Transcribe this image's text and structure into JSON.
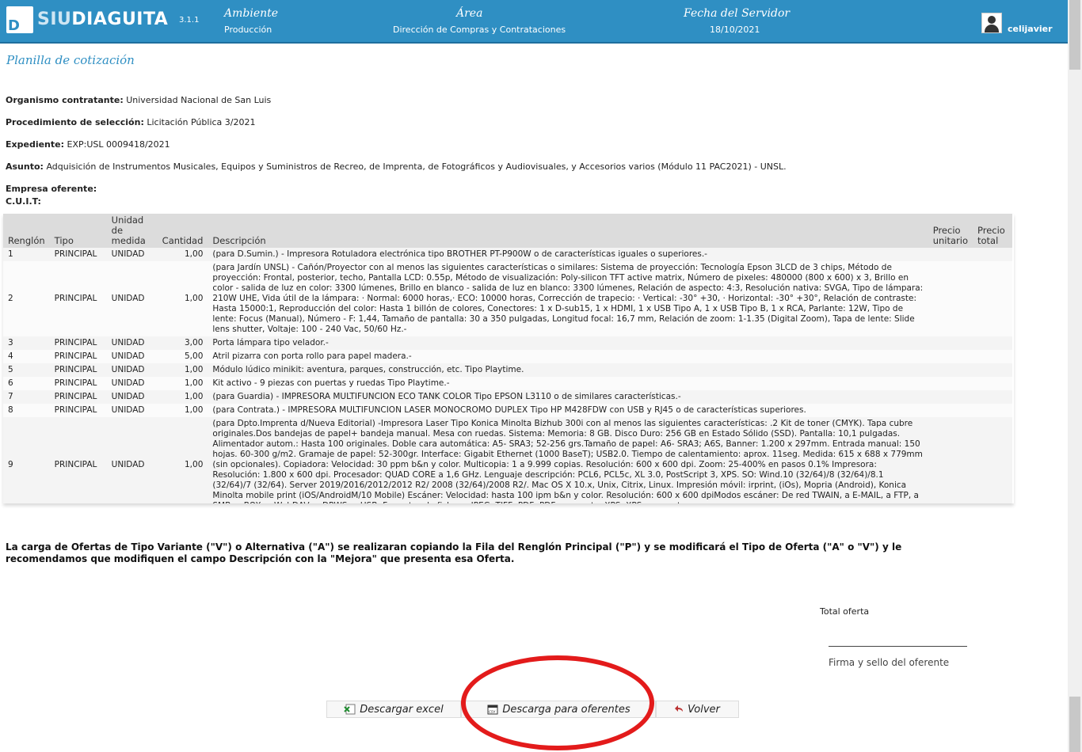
{
  "header": {
    "brand_prefix": "SIU",
    "brand_suffix": "DIAGUITA",
    "version": "3.1.1",
    "ambiente_label": "Ambiente",
    "ambiente_value": "Producción",
    "area_label": "Área",
    "area_value": "Dirección de Compras y Contrataciones",
    "fecha_label": "Fecha del Servidor",
    "fecha_value": "18/10/2021",
    "username": "celijavier"
  },
  "page_title": "Planilla de cotización",
  "fields": {
    "organismo_label": "Organismo contratante:",
    "organismo_value": "Universidad Nacional de San Luis",
    "procedimiento_label": "Procedimiento de selección:",
    "procedimiento_value": "Licitación Pública 3/2021",
    "expediente_label": "Expediente:",
    "expediente_value": "EXP:USL 0009418/2021",
    "asunto_label": "Asunto:",
    "asunto_value": "Adquisición de Instrumentos Musicales, Equipos y Suministros de Recreo, de Imprenta, de Fotográficos y Audiovisuales, y Accesorios varios (Módulo 11 PAC2021) - UNSL.",
    "empresa_label": "Empresa oferente:",
    "cuit_label": "C.U.I.T:"
  },
  "table": {
    "headers": [
      "Renglón",
      "Tipo",
      "Unidad de medida",
      "Cantidad",
      "Descripción",
      "Precio unitario",
      "Precio total"
    ],
    "rows": [
      {
        "renglon": "1",
        "tipo": "PRINCIPAL",
        "unidad": "UNIDAD",
        "cantidad": "1,00",
        "descripcion": "(para D.Sumin.) - Impresora Rotuladora electrónica tipo BROTHER PT-P900W o de características iguales o superiores.-"
      },
      {
        "renglon": "2",
        "tipo": "PRINCIPAL",
        "unidad": "UNIDAD",
        "cantidad": "1,00",
        "descripcion": "(para Jardín UNSL) - Cañón/Proyector con al menos las siguientes características o similares: Sistema de proyección: Tecnología Epson 3LCD de 3 chips, Método de proyección: Frontal, posterior, techo, Pantalla LCD: 0.55p, Método de visualización: Poly-silicon TFT active matrix, Número de pixeles: 480000 (800 x 600) x 3, Brillo en color - salida de luz en color: 3300 lúmenes, Brillo en blanco - salida de luz en blanco: 3300 lúmenes, Relación de aspecto: 4:3, Resolución nativa: SVGA, Tipo de lámpara: 210W UHE, Vida útil de la lámpara: · Normal: 6000 horas,· ECO: 10000 horas, Corrección de trapecio: · Vertical: -30° +30, · Horizontal: -30° +30°, Relación de contraste: Hasta 15000:1, Reproducción del color: Hasta 1 billón de colores, Conectores: 1 x D-sub15, 1 x HDMI, 1 x USB Tipo A, 1 x USB Tipo B, 1 x RCA, Parlante: 12W, Tipo de lente: Focus (Manual), Número - F: 1,44, Tamaño de pantalla: 30 a 350 pulgadas, Longitud focal: 16,7 mm, Relación de zoom: 1-1.35 (Digital Zoom), Tapa de lente: Slide lens shutter, Voltaje: 100 - 240 Vac, 50/60 Hz.-"
      },
      {
        "renglon": "3",
        "tipo": "PRINCIPAL",
        "unidad": "UNIDAD",
        "cantidad": "3,00",
        "descripcion": "Porta lámpara tipo velador.-"
      },
      {
        "renglon": "4",
        "tipo": "PRINCIPAL",
        "unidad": "UNIDAD",
        "cantidad": "5,00",
        "descripcion": "Atril pizarra con porta rollo para papel madera.-"
      },
      {
        "renglon": "5",
        "tipo": "PRINCIPAL",
        "unidad": "UNIDAD",
        "cantidad": "1,00",
        "descripcion": "Módulo lúdico minikit: aventura, parques, construcción, etc. Tipo Playtime."
      },
      {
        "renglon": "6",
        "tipo": "PRINCIPAL",
        "unidad": "UNIDAD",
        "cantidad": "1,00",
        "descripcion": "Kit activo - 9 piezas con puertas y ruedas Tipo Playtime.-"
      },
      {
        "renglon": "7",
        "tipo": "PRINCIPAL",
        "unidad": "UNIDAD",
        "cantidad": "1,00",
        "descripcion": "(para Guardia) - IMPRESORA MULTIFUNCION ECO TANK COLOR Tipo EPSON L3110 o de similares características.-"
      },
      {
        "renglon": "8",
        "tipo": "PRINCIPAL",
        "unidad": "UNIDAD",
        "cantidad": "1,00",
        "descripcion": "(para Contrata.) - IMPRESORA MULTIFUNCION LASER MONOCROMO DUPLEX Tipo HP M428FDW con USB y RJ45 o de características superiores."
      },
      {
        "renglon": "9",
        "tipo": "PRINCIPAL",
        "unidad": "UNIDAD",
        "cantidad": "1,00",
        "descripcion": "(para Dpto.Imprenta d/Nueva Editorial) -Impresora Laser Tipo Konica Minolta Bizhub 300i con al menos las siguientes características: .2 Kit de toner (CMYK). Tapa cubre originales.Dos bandejas de papel+ bandeja manual. Mesa con ruedas. Sistema: Memoria: 8 GB. Disco Duro: 256 GB en Estado Sólido (SSD). Pantalla: 10,1 pulgadas. Alimentador autom.: Hasta 100 originales. Doble cara automática: A5- SRA3; 52-256 grs.Tamaño de papel: A6- SRA3; A6S, Banner: 1.200 x 297mm. Entrada manual: 150 hojas. 60-300 g/m2. Gramaje de papel: 52-300gr. Interface: Gigabit Ethernet (1000 BaseT); USB2.0. Tiempo de calentamiento: aprox. 11seg. Medida: 615 x 688 x 779mm (sin opcionales). Copiadora: Velocidad: 30 ppm b&n y color. Multicopia: 1 a 9.999 copias. Resolución: 600 x 600 dpi. Zoom: 25-400% en pasos 0.1% Impresora: Resolución: 1.800 x 600 dpi. Procesador: QUAD CORE a 1,6 GHz. Lenguaje descripción: PCL6, PCL5c, XL 3.0, PostScript 3, XPS. SO: Wind.10 (32/64)/8 (32/64)/8.1 (32/64)/7 (32/64). Server 2019/2016/2012/2012 R2/ 2008 (32/64)/2008 R2/. Mac OS X 10.x, Unix, Citrix, Linux. Impresión móvil: irprint, (iOs), Mopria (Android), Konica Minolta mobile print (iOS/AndroidM/10 Mobile) Escáner: Velocidad: hasta 100 ipm b&n y color. Resolución: 600 x 600 dpiModos escáner: De red TWAIN, a E-MAIL, a FTP, a SMB, a BOX, a WebDAV, a DPWS, a USB. Formatos de fichero: JPEG, TIFF, PDF, PDF compacto, XPS, XPS compacto.-"
      }
    ]
  },
  "notice": "La carga de Ofertas de Tipo Variante (\"V\") o Alternativa (\"A\") se realizaran copiando la Fila del Renglón Principal (\"P\") y se modificará el Tipo de Oferta (\"A\" o \"V\") y le recomendamos que modifiquen el campo Descripción con la \"Mejora\" que presenta esa Oferta.",
  "total_label": "Total oferta",
  "signature_label": "Firma y sello del oferente",
  "buttons": {
    "excel": "Descargar excel",
    "oferentes": "Descarga para oferentes",
    "volver": "Volver"
  },
  "colors": {
    "header_bg": "#2f8fc3",
    "title": "#2f8fc3",
    "highlight": "#e31b1b"
  }
}
